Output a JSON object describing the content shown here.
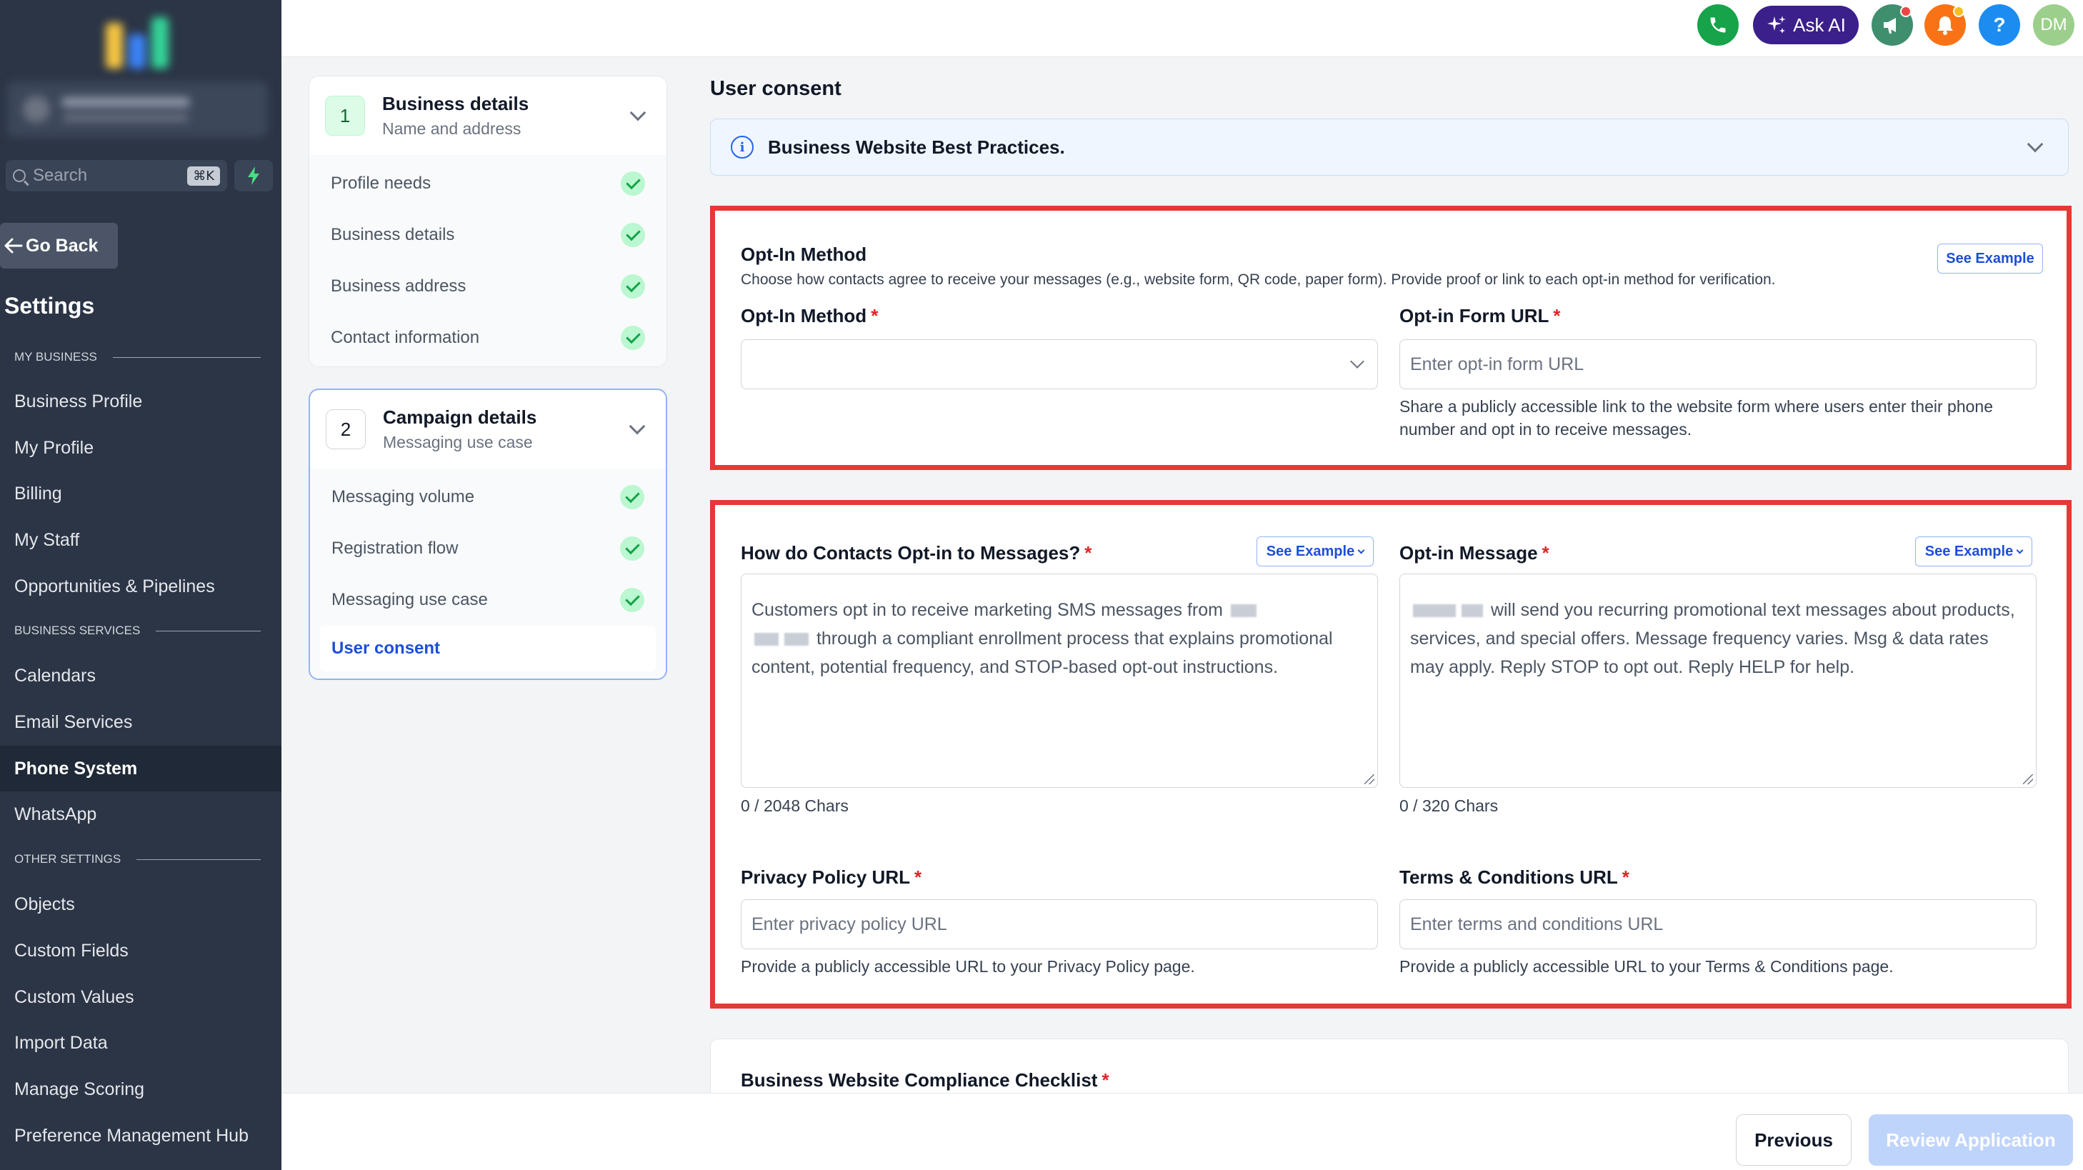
{
  "sidebar": {
    "search_placeholder": "Search",
    "search_shortcut": "⌘K",
    "go_back": "Go Back",
    "settings_title": "Settings",
    "sections": {
      "my_business": "MY BUSINESS",
      "business_services": "BUSINESS SERVICES",
      "other_settings": "OTHER SETTINGS"
    },
    "items": [
      {
        "label": "Business Profile"
      },
      {
        "label": "My Profile"
      },
      {
        "label": "Billing"
      },
      {
        "label": "My Staff"
      },
      {
        "label": "Opportunities & Pipelines"
      },
      {
        "label": "Calendars"
      },
      {
        "label": "Email Services"
      },
      {
        "label": "Phone System"
      },
      {
        "label": "WhatsApp"
      },
      {
        "label": "Objects"
      },
      {
        "label": "Custom Fields"
      },
      {
        "label": "Custom Values"
      },
      {
        "label": "Import Data"
      },
      {
        "label": "Manage Scoring"
      },
      {
        "label": "Preference Management Hub"
      }
    ],
    "active_item": "Phone System"
  },
  "topbar": {
    "ask_ai": "Ask AI",
    "help": "?",
    "avatar_initials": "DM",
    "colors": {
      "phone": "#16a34a",
      "ai": "#3b1f8a",
      "megaphone": "#3f8f6f",
      "bell": "#f97316",
      "help": "#1d8cf0",
      "avatar": "#9ccf8c"
    }
  },
  "steps": [
    {
      "number": "1",
      "title": "Business details",
      "subtitle": "Name and address",
      "items": [
        "Profile needs",
        "Business details",
        "Business address",
        "Contact information"
      ]
    },
    {
      "number": "2",
      "title": "Campaign details",
      "subtitle": "Messaging use case",
      "items": [
        "Messaging volume",
        "Registration flow",
        "Messaging use case"
      ],
      "current_item": "User consent"
    }
  ],
  "main": {
    "title": "User consent",
    "best_practices": "Business Website Best Practices.",
    "opt_in": {
      "title": "Opt-In Method",
      "description": "Choose how contacts agree to receive your messages (e.g., website form, QR code, paper form). Provide proof or link to each opt-in method for verification.",
      "see_example": "See Example",
      "method_label": "Opt-In Method",
      "method_value": "",
      "form_url_label": "Opt-in Form URL",
      "form_url_placeholder": "Enter opt-in form URL",
      "form_url_helper": "Share a publicly accessible link to the website form where users enter their phone number and opt in to receive messages."
    },
    "consent": {
      "how_label": "How do Contacts Opt-in to Messages?",
      "how_text_a": "Customers opt in to receive marketing SMS messages from",
      "how_text_b": "through a compliant enrollment process that explains promotional content, potential frequency, and STOP-based opt-out instructions.",
      "how_counter": "0 / 2048 Chars",
      "message_label": "Opt-in Message",
      "message_text": "will send you recurring promotional text messages about products, services, and special offers. Message frequency varies. Msg & data rates may apply. Reply STOP to opt out. Reply HELP for help.",
      "message_counter": "0 / 320 Chars",
      "see_example": "See Example",
      "privacy_label": "Privacy Policy URL",
      "privacy_placeholder": "Enter privacy policy URL",
      "privacy_helper": "Provide a publicly accessible URL to your Privacy Policy page.",
      "terms_label": "Terms & Conditions URL",
      "terms_placeholder": "Enter terms and conditions URL",
      "terms_helper": "Provide a publicly accessible URL to your Terms & Conditions page."
    },
    "checklist_title": "Business Website Compliance Checklist",
    "required_mark": "*"
  },
  "footer": {
    "previous": "Previous",
    "review": "Review Application"
  }
}
